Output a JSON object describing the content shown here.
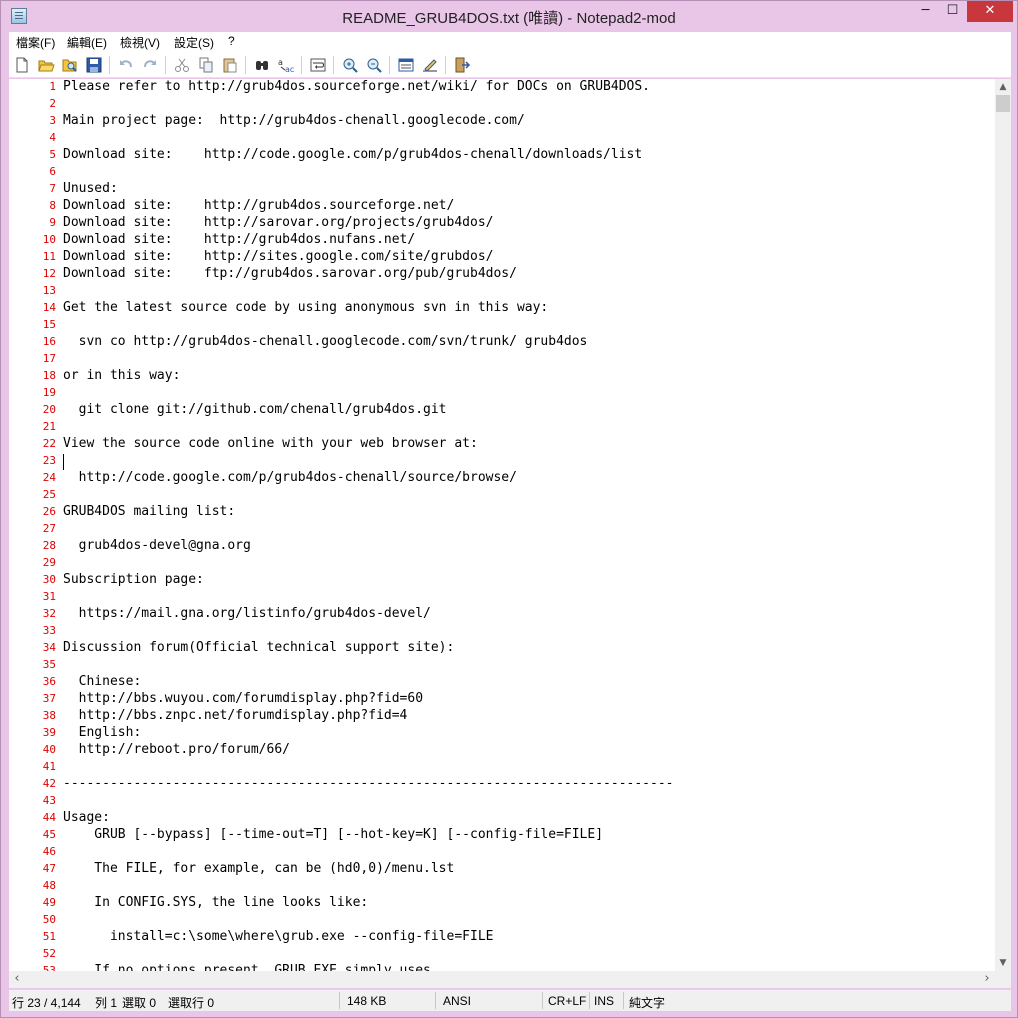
{
  "window": {
    "title": "README_GRUB4DOS.txt (唯讀) - Notepad2-mod",
    "minimize": "─",
    "maximize": "☐",
    "close": "✕"
  },
  "menu": [
    "檔案(F)",
    "編輯(E)",
    "檢視(V)",
    "設定(S)",
    "?"
  ],
  "toolbar": [
    "new-icon",
    "open-icon",
    "browse-icon",
    "save-icon",
    "undo-icon",
    "redo-icon",
    "cut-icon",
    "copy-icon",
    "paste-icon",
    "find-icon",
    "replace-icon",
    "word-wrap-icon",
    "zoom-in-icon",
    "zoom-out-icon",
    "scheme-icon",
    "customize-scheme-icon",
    "exit-icon"
  ],
  "editor": {
    "line_numbers": [
      "1",
      "2",
      "3",
      "4",
      "5",
      "6",
      "7",
      "8",
      "9",
      "10",
      "11",
      "12",
      "13",
      "14",
      "15",
      "16",
      "17",
      "18",
      "19",
      "20",
      "21",
      "22",
      "23",
      "24",
      "25",
      "26",
      "27",
      "28",
      "29",
      "30",
      "31",
      "32",
      "33",
      "34",
      "35",
      "36",
      "37",
      "38",
      "39",
      "40",
      "41",
      "42",
      "43",
      "44",
      "45",
      "46",
      "47",
      "48",
      "49",
      "50",
      "51",
      "52",
      "53"
    ],
    "lines": [
      "Please refer to http://grub4dos.sourceforge.net/wiki/ for DOCs on GRUB4DOS.",
      "",
      "Main project page:  http://grub4dos-chenall.googlecode.com/",
      "",
      "Download site:    http://code.google.com/p/grub4dos-chenall/downloads/list",
      "",
      "Unused:",
      "Download site:    http://grub4dos.sourceforge.net/",
      "Download site:    http://sarovar.org/projects/grub4dos/",
      "Download site:    http://grub4dos.nufans.net/",
      "Download site:    http://sites.google.com/site/grubdos/",
      "Download site:    ftp://grub4dos.sarovar.org/pub/grub4dos/",
      "",
      "Get the latest source code by using anonymous svn in this way:",
      "",
      "  svn co http://grub4dos-chenall.googlecode.com/svn/trunk/ grub4dos",
      "",
      "or in this way:",
      "",
      "  git clone git://github.com/chenall/grub4dos.git",
      "",
      "View the source code online with your web browser at:",
      "",
      "  http://code.google.com/p/grub4dos-chenall/source/browse/",
      "",
      "GRUB4DOS mailing list:",
      "",
      "  grub4dos-devel@gna.org",
      "",
      "Subscription page:",
      "",
      "  https://mail.gna.org/listinfo/grub4dos-devel/",
      "",
      "Discussion forum(Official technical support site):",
      "",
      "  Chinese:",
      "  http://bbs.wuyou.com/forumdisplay.php?fid=60",
      "  http://bbs.znpc.net/forumdisplay.php?fid=4",
      "  English:",
      "  http://reboot.pro/forum/66/",
      "",
      "------------------------------------------------------------------------------",
      "",
      "Usage:",
      "    GRUB [--bypass] [--time-out=T] [--hot-key=K] [--config-file=FILE]",
      "",
      "    The FILE, for example, can be (hd0,0)/menu.lst",
      "",
      "    In CONFIG.SYS, the line looks like:",
      "",
      "      install=c:\\some\\where\\grub.exe --config-file=FILE",
      "",
      "    If no options present, GRUB.EXE simply uses"
    ]
  },
  "scrollbar": {
    "up": "▲",
    "down": "▼",
    "left": "‹",
    "right": "›"
  },
  "status": {
    "line": "行 23 / 4,144",
    "col": "列 1",
    "sel": "選取 0",
    "sel_lines": "選取行 0",
    "size": "148 KB",
    "encoding": "ANSI",
    "eol": "CR+LF",
    "ovr": "INS",
    "lexer": "純文字"
  }
}
